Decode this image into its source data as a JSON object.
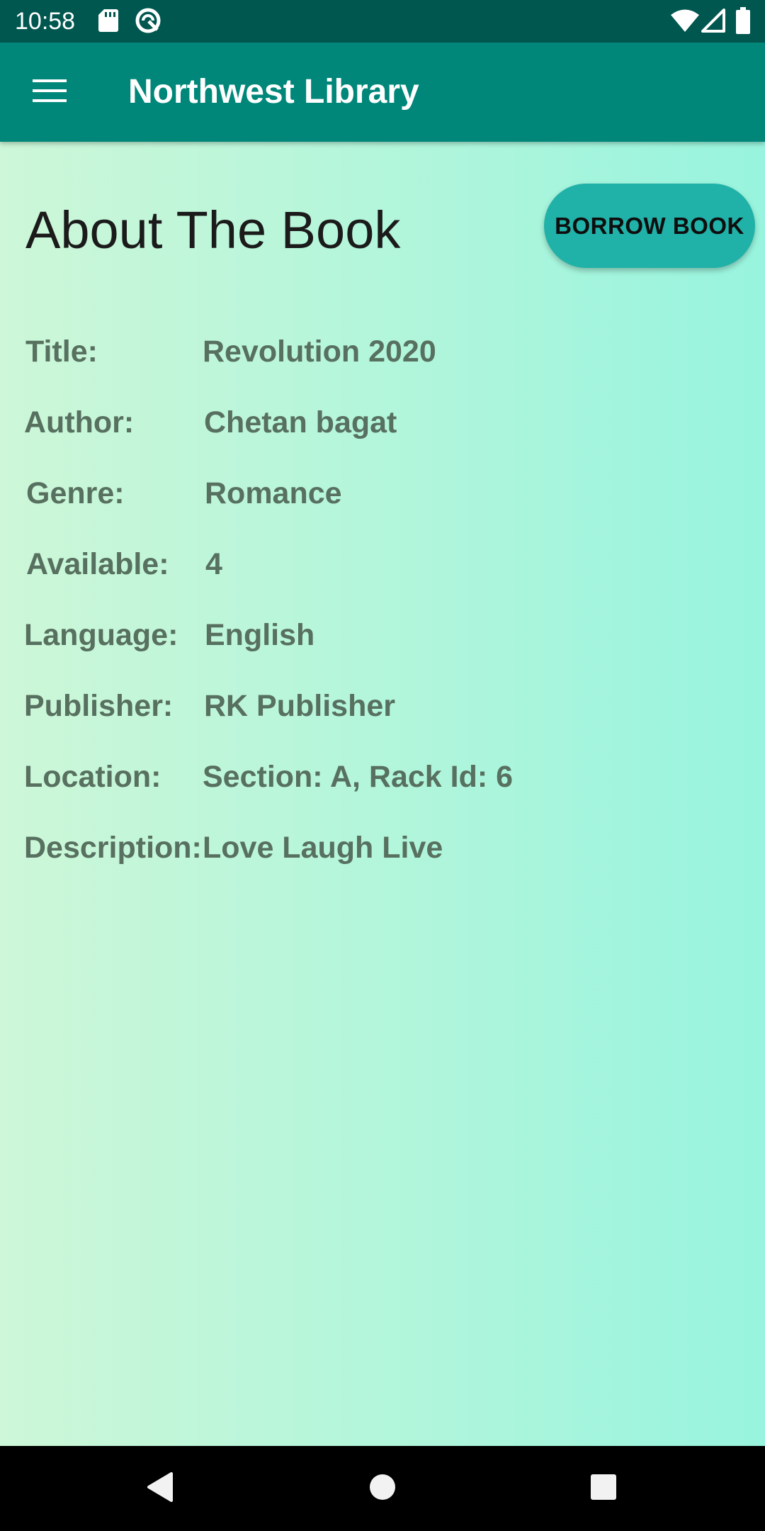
{
  "status_bar": {
    "time": "10:58",
    "icons": [
      "sd-card-icon",
      "data-saver-icon",
      "wifi-icon",
      "cell-signal-icon",
      "battery-icon"
    ]
  },
  "app_bar": {
    "title": "Northwest Library",
    "menu_icon": "hamburger-menu-icon",
    "background": "#00877a"
  },
  "page": {
    "heading": "About The Book",
    "borrow_button": "BORROW BOOK"
  },
  "book": {
    "fields": [
      {
        "label": "Title:",
        "value": "Revolution 2020"
      },
      {
        "label": "Author:",
        "value": "Chetan bagat"
      },
      {
        "label": "Genre:",
        "value": "Romance"
      },
      {
        "label": "Available:",
        "value": "4"
      },
      {
        "label": "Language:",
        "value": "English"
      },
      {
        "label": "Publisher:",
        "value": "RK Publisher"
      },
      {
        "label": "Location:",
        "value": "Section: A, Rack Id: 6"
      },
      {
        "label": "Description:",
        "value": "Love Laugh Live"
      }
    ]
  },
  "colors": {
    "status_bar": "#00574f",
    "accent_button": "#20b1a8",
    "field_text": "#57705f",
    "gradient_start": "#cdf7d8",
    "gradient_end": "#98f4de"
  },
  "nav_bar": {
    "icons": [
      "back-icon",
      "home-icon",
      "recents-icon"
    ]
  }
}
